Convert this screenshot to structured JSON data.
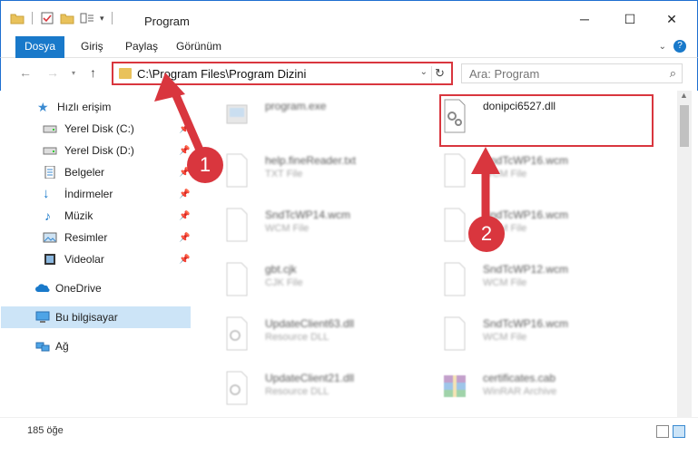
{
  "window": {
    "title": "Program",
    "controls": {
      "minimize": "─",
      "maximize": "☐",
      "close": "✕"
    }
  },
  "ribbon": {
    "tabs": [
      {
        "label": "Dosya",
        "active": true
      },
      {
        "label": "Giriş"
      },
      {
        "label": "Paylaş"
      },
      {
        "label": "Görünüm"
      }
    ],
    "expand_icon": "chevron-down-icon",
    "help_icon": "help-icon"
  },
  "address": {
    "path": "C:\\Program Files\\Program Dizini",
    "search_placeholder": "Ara: Program"
  },
  "navigation": {
    "items": [
      {
        "label": "Hızlı erişim",
        "icon": "star-icon",
        "pinned": false
      },
      {
        "label": "Yerel Disk (C:)",
        "icon": "drive-icon",
        "pinned": true
      },
      {
        "label": "Yerel Disk (D:)",
        "icon": "drive-icon",
        "pinned": true
      },
      {
        "label": "Belgeler",
        "icon": "documents-icon",
        "pinned": true
      },
      {
        "label": "İndirmeler",
        "icon": "download-icon",
        "pinned": true
      },
      {
        "label": "Müzik",
        "icon": "music-icon",
        "pinned": true
      },
      {
        "label": "Resimler",
        "icon": "pictures-icon",
        "pinned": true
      },
      {
        "label": "Videolar",
        "icon": "videos-icon",
        "pinned": true
      },
      {
        "label": "OneDrive",
        "icon": "cloud-icon",
        "pinned": false
      },
      {
        "label": "Bu bilgisayar",
        "icon": "computer-icon",
        "pinned": false,
        "selected": true
      },
      {
        "label": "Ağ",
        "icon": "network-icon",
        "pinned": false
      }
    ]
  },
  "files": [
    {
      "name": "program.exe",
      "type": "",
      "icon": "exe-icon"
    },
    {
      "name": "donipci6527.dll",
      "type": "",
      "icon": "dll-gear-icon",
      "highlighted": true
    },
    {
      "name": "help.fineReader.txt",
      "type": "TXT File",
      "icon": "txt-file-icon"
    },
    {
      "name": "SndTcWP16.wcm",
      "type": "WCM File",
      "icon": "file-icon"
    },
    {
      "name": "SndTcWP14.wcm",
      "type": "WCM File",
      "icon": "file-icon"
    },
    {
      "name": "SndTcWP16.wcm",
      "type": "WCM File",
      "icon": "file-icon"
    },
    {
      "name": "gbt.cjk",
      "type": "CJK File",
      "icon": "file-icon"
    },
    {
      "name": "SndTcWP12.wcm",
      "type": "WCM File",
      "icon": "file-icon"
    },
    {
      "name": "UpdateClient63.dll",
      "type": "Resource DLL",
      "icon": "dll-gear-icon"
    },
    {
      "name": "SndTcWP16.wcm",
      "type": "WCM File",
      "icon": "file-icon"
    },
    {
      "name": "UpdateClient21.dll",
      "type": "Resource DLL",
      "icon": "dll-gear-icon"
    },
    {
      "name": "certificates.cab",
      "type": "WinRAR Archive",
      "icon": "winrar-icon"
    }
  ],
  "status": {
    "item_count": "185 öğe"
  },
  "annotations": {
    "step1": "1",
    "step2": "2"
  },
  "colors": {
    "accent": "#1979ca",
    "highlight_red": "#d9363e",
    "selection": "#cce4f7"
  }
}
